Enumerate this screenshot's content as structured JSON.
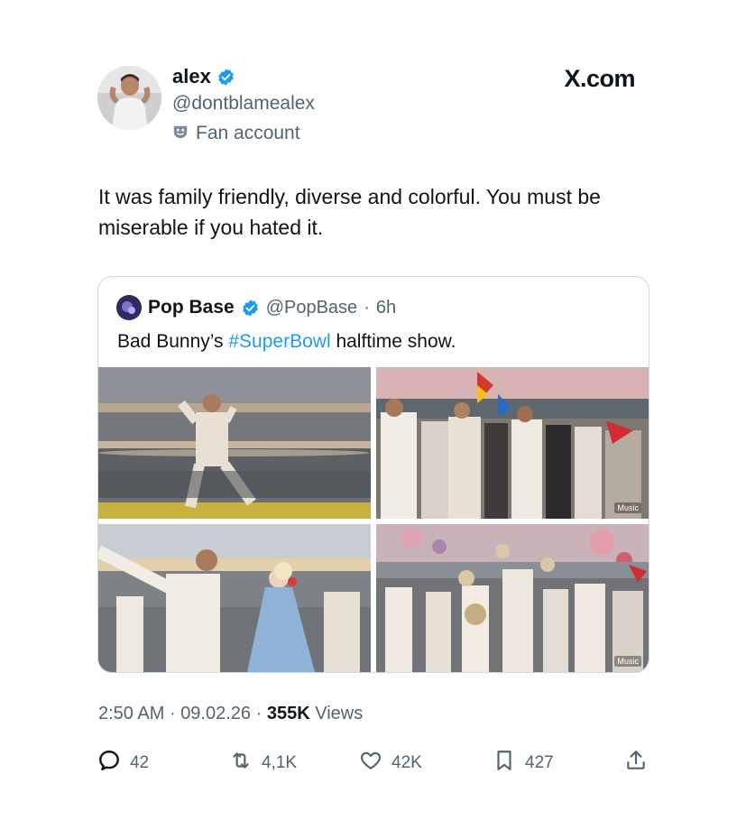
{
  "author": {
    "display_name": "alex",
    "handle": "@dontblamealex",
    "label": "Fan account",
    "verified": true
  },
  "brand": "X.com",
  "tweet_text": "It was family friendly, diverse and colorful. You must be miserable if you hated it.",
  "quoted": {
    "display_name": "Pop Base",
    "handle": "@PopBase",
    "separator": "·",
    "time": "6h",
    "text_before": "Bad Bunny’s ",
    "hashtag": "#SuperBowl",
    "text_after": " halftime show.",
    "media_badge": "Music"
  },
  "meta": {
    "time": "2:50 AM",
    "date": "09.02.26",
    "views_count": "355K",
    "views_label": "Views",
    "separator": "·"
  },
  "actions": {
    "replies": "42",
    "reposts": "4,1K",
    "likes": "42K",
    "bookmarks": "427"
  },
  "colors": {
    "link": "#1d9bf0",
    "verified": "#1d9bf0",
    "secondary_text": "#536471",
    "primary_text": "#0f1419"
  },
  "icons": [
    "verified-badge-icon",
    "affiliate-mask-icon",
    "reply-icon",
    "repost-icon",
    "like-icon",
    "bookmark-icon",
    "share-icon"
  ]
}
